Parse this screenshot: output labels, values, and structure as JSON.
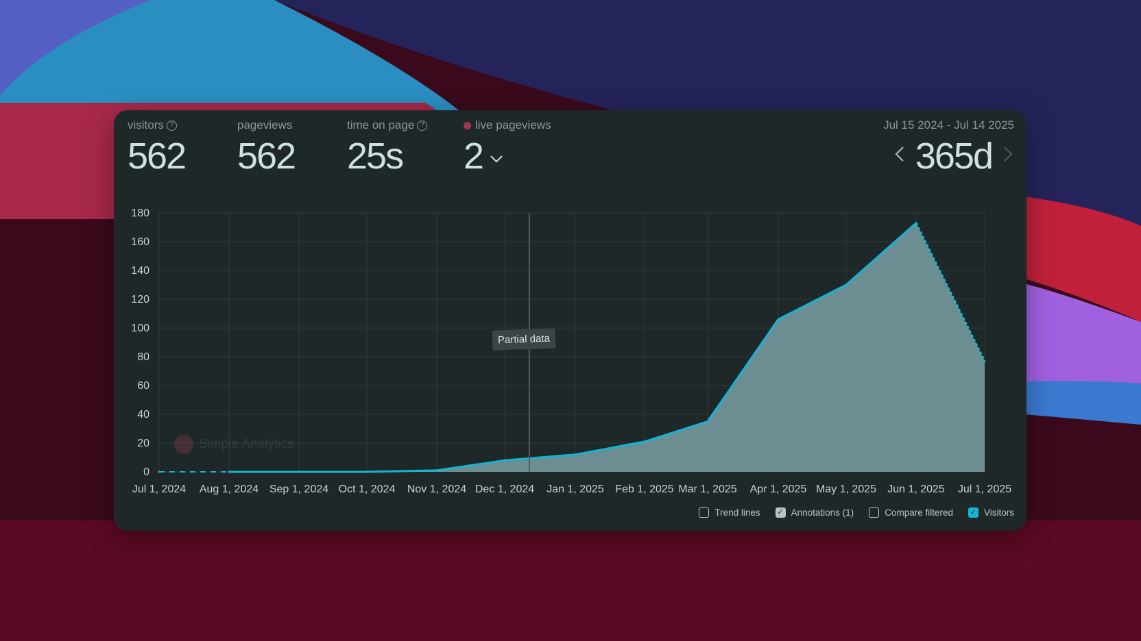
{
  "metrics": [
    {
      "label": "visitors",
      "value": "562",
      "help": "?"
    },
    {
      "label": "pageviews",
      "value": "562"
    },
    {
      "label": "time on page",
      "value": "25s",
      "help": "?"
    },
    {
      "label": "live pageviews",
      "value": "2"
    }
  ],
  "range": {
    "dates": "Jul 15 2024 - Jul 14 2025",
    "value": "365d",
    "prev_icon": "chevron-left-icon",
    "next_icon": "chevron-right-icon"
  },
  "annotation": {
    "label": "Partial data"
  },
  "watermark": {
    "text": "Simple Analytics"
  },
  "legend": [
    {
      "label": "Trend lines",
      "checked": false
    },
    {
      "label": "Annotations (1)",
      "checked": true
    },
    {
      "label": "Compare filtered",
      "checked": false
    },
    {
      "label": "Visitors",
      "checked": true
    }
  ],
  "colors": {
    "accent": "#16b4d4",
    "area": "#7a9fa3",
    "card": "#1f2829",
    "live": "#a3344f"
  },
  "chart_data": {
    "type": "area",
    "x": [
      "Jul 1, 2024",
      "Aug 1, 2024",
      "Sep 1, 2024",
      "Oct 1, 2024",
      "Nov 1, 2024",
      "Dec 1, 2024",
      "Jan 1, 2025",
      "Feb 1, 2025",
      "Mar 1, 2025",
      "Apr 1, 2025",
      "May 1, 2025",
      "Jun 1, 2025",
      "Jul 1, 2025"
    ],
    "series": [
      {
        "name": "Visitors",
        "values": [
          0,
          0,
          0,
          0,
          1,
          8,
          12,
          21,
          35,
          106,
          130,
          173,
          77
        ]
      }
    ],
    "yticks": [
      0,
      20,
      40,
      60,
      80,
      100,
      120,
      140,
      160,
      180
    ],
    "ylim": [
      0,
      180
    ],
    "grid": true,
    "annotation_x": "Dec 1, 2024"
  }
}
